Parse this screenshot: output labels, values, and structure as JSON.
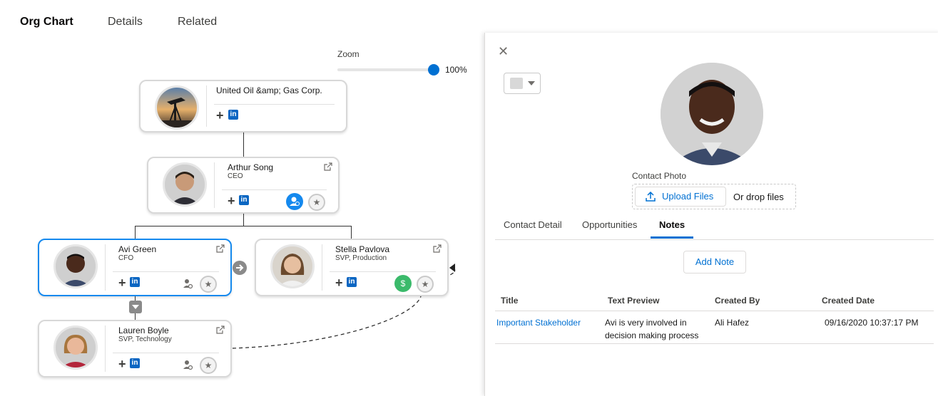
{
  "tabs": [
    {
      "label": "Org Chart"
    },
    {
      "label": "Details"
    },
    {
      "label": "Related"
    }
  ],
  "zoom": {
    "label": "Zoom",
    "value": "100%",
    "fraction": 1.0
  },
  "org": {
    "company": {
      "name": "United Oil &amp; Gas Corp."
    },
    "ceo": {
      "name": "Arthur Song",
      "title": "CEO"
    },
    "cfo": {
      "name": "Avi Green",
      "title": "CFO"
    },
    "svp_prod": {
      "name": "Stella Pavlova",
      "title": "SVP, Production"
    },
    "svp_tech": {
      "name": "Lauren Boyle",
      "title": "SVP, Technology"
    },
    "linkedin_glyph": "in",
    "plus_glyph": "+",
    "star_glyph": "★",
    "dollar_glyph": "$"
  },
  "colors": {
    "accent": "#0070d2",
    "selected_border": "#1589ee",
    "badge_blue": "#1589ee",
    "badge_green": "#3bba6b"
  },
  "panel": {
    "close_glyph": "✕",
    "contact_photo_label": "Contact Photo",
    "upload_button": "Upload Files",
    "drop_text": "Or drop files",
    "sub_tabs": [
      {
        "label": "Contact Detail"
      },
      {
        "label": "Opportunities"
      },
      {
        "label": "Notes"
      }
    ],
    "add_note": "Add Note",
    "notes_table": {
      "headers": [
        "Title",
        "Text Preview",
        "Created By",
        "Created Date"
      ],
      "rows": [
        {
          "title": "Important Stakeholder",
          "preview": "Avi is very involved in decision making process",
          "created_by": "Ali Hafez",
          "created_date": "09/16/2020 10:37:17 PM"
        }
      ]
    }
  }
}
